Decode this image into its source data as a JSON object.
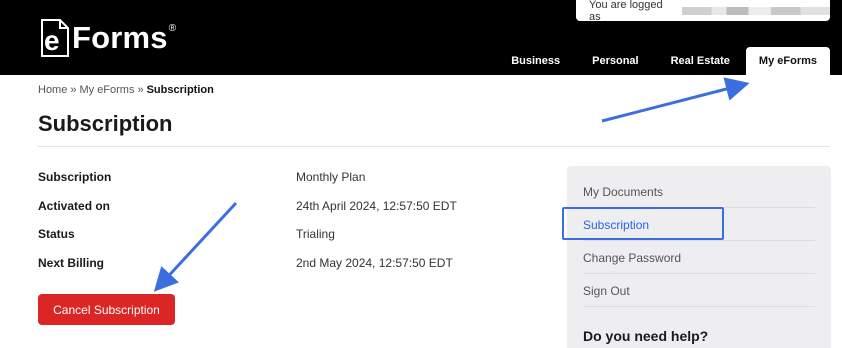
{
  "header": {
    "logo_e": "e",
    "logo_rest": "Forms",
    "logo_reg": "®",
    "login_text": "You are logged as",
    "nav": [
      {
        "label": "Business"
      },
      {
        "label": "Personal"
      },
      {
        "label": "Real Estate"
      },
      {
        "label": "My eForms",
        "active": true
      }
    ]
  },
  "breadcrumb": {
    "items": [
      "Home",
      "My eForms"
    ],
    "separator": "»",
    "current": "Subscription"
  },
  "page_title": "Subscription",
  "details": [
    {
      "label": "Subscription",
      "value": "Monthly Plan"
    },
    {
      "label": "Activated on",
      "value": "24th April 2024, 12:57:50 EDT"
    },
    {
      "label": "Status",
      "value": "Trialing"
    },
    {
      "label": "Next Billing",
      "value": "2nd May 2024, 12:57:50 EDT"
    }
  ],
  "cancel_button": "Cancel Subscription",
  "sidebar": {
    "links": [
      {
        "label": "My Documents"
      },
      {
        "label": "Subscription",
        "active": true
      },
      {
        "label": "Change Password"
      },
      {
        "label": "Sign Out"
      }
    ],
    "help_title": "Do you need help?"
  },
  "colors": {
    "header_bg": "#000000",
    "danger": "#dc2626",
    "annotation_blue": "#3b6fe0",
    "link_active": "#2563eb",
    "sidebar_bg": "#eeeef1"
  },
  "icons": [
    "document-icon",
    "annotation-arrow-icon"
  ]
}
